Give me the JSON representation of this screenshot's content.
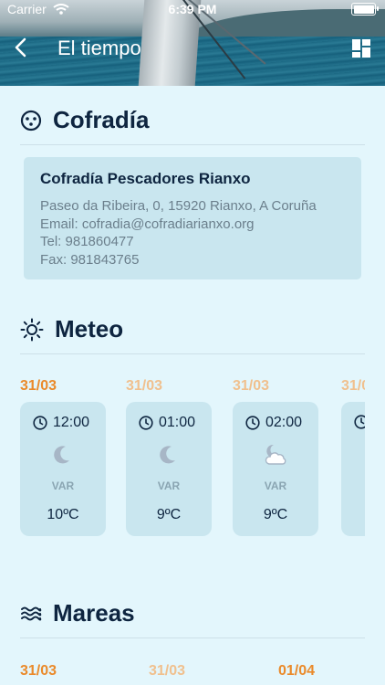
{
  "status_bar": {
    "carrier": "Carrier",
    "time": "6:39 PM"
  },
  "nav": {
    "title": "El tiempo"
  },
  "cofradia": {
    "heading": "Cofradía",
    "name": "Cofradía Pescadores Rianxo",
    "address": "Paseo da Ribeira, 0, 15920 Rianxo, A Coruña",
    "email": "Email: cofradia@cofradiarianxo.org",
    "tel": "Tel: 981860477",
    "fax": "Fax: 981843765"
  },
  "meteo": {
    "heading": "Meteo",
    "forecasts": [
      {
        "date": "31/03",
        "time": "12:00",
        "sky_icon": "moon-icon",
        "wind": "VAR",
        "temp": "10ºC"
      },
      {
        "date": "31/03",
        "time": "01:00",
        "sky_icon": "moon-icon",
        "wind": "VAR",
        "temp": "9ºC"
      },
      {
        "date": "31/03",
        "time": "02:00",
        "sky_icon": "moon-cloud-icon",
        "wind": "VAR",
        "temp": "9ºC"
      },
      {
        "date": "31/0"
      }
    ]
  },
  "mareas": {
    "heading": "Mareas",
    "dates": [
      "31/03",
      "31/03",
      "01/04"
    ]
  },
  "colors": {
    "background": "#e3f6fc",
    "card": "#c9e6ef",
    "date_accent": "#ea8a2a",
    "date_faded": "#f0c08e",
    "title_text": "#0e2540"
  }
}
